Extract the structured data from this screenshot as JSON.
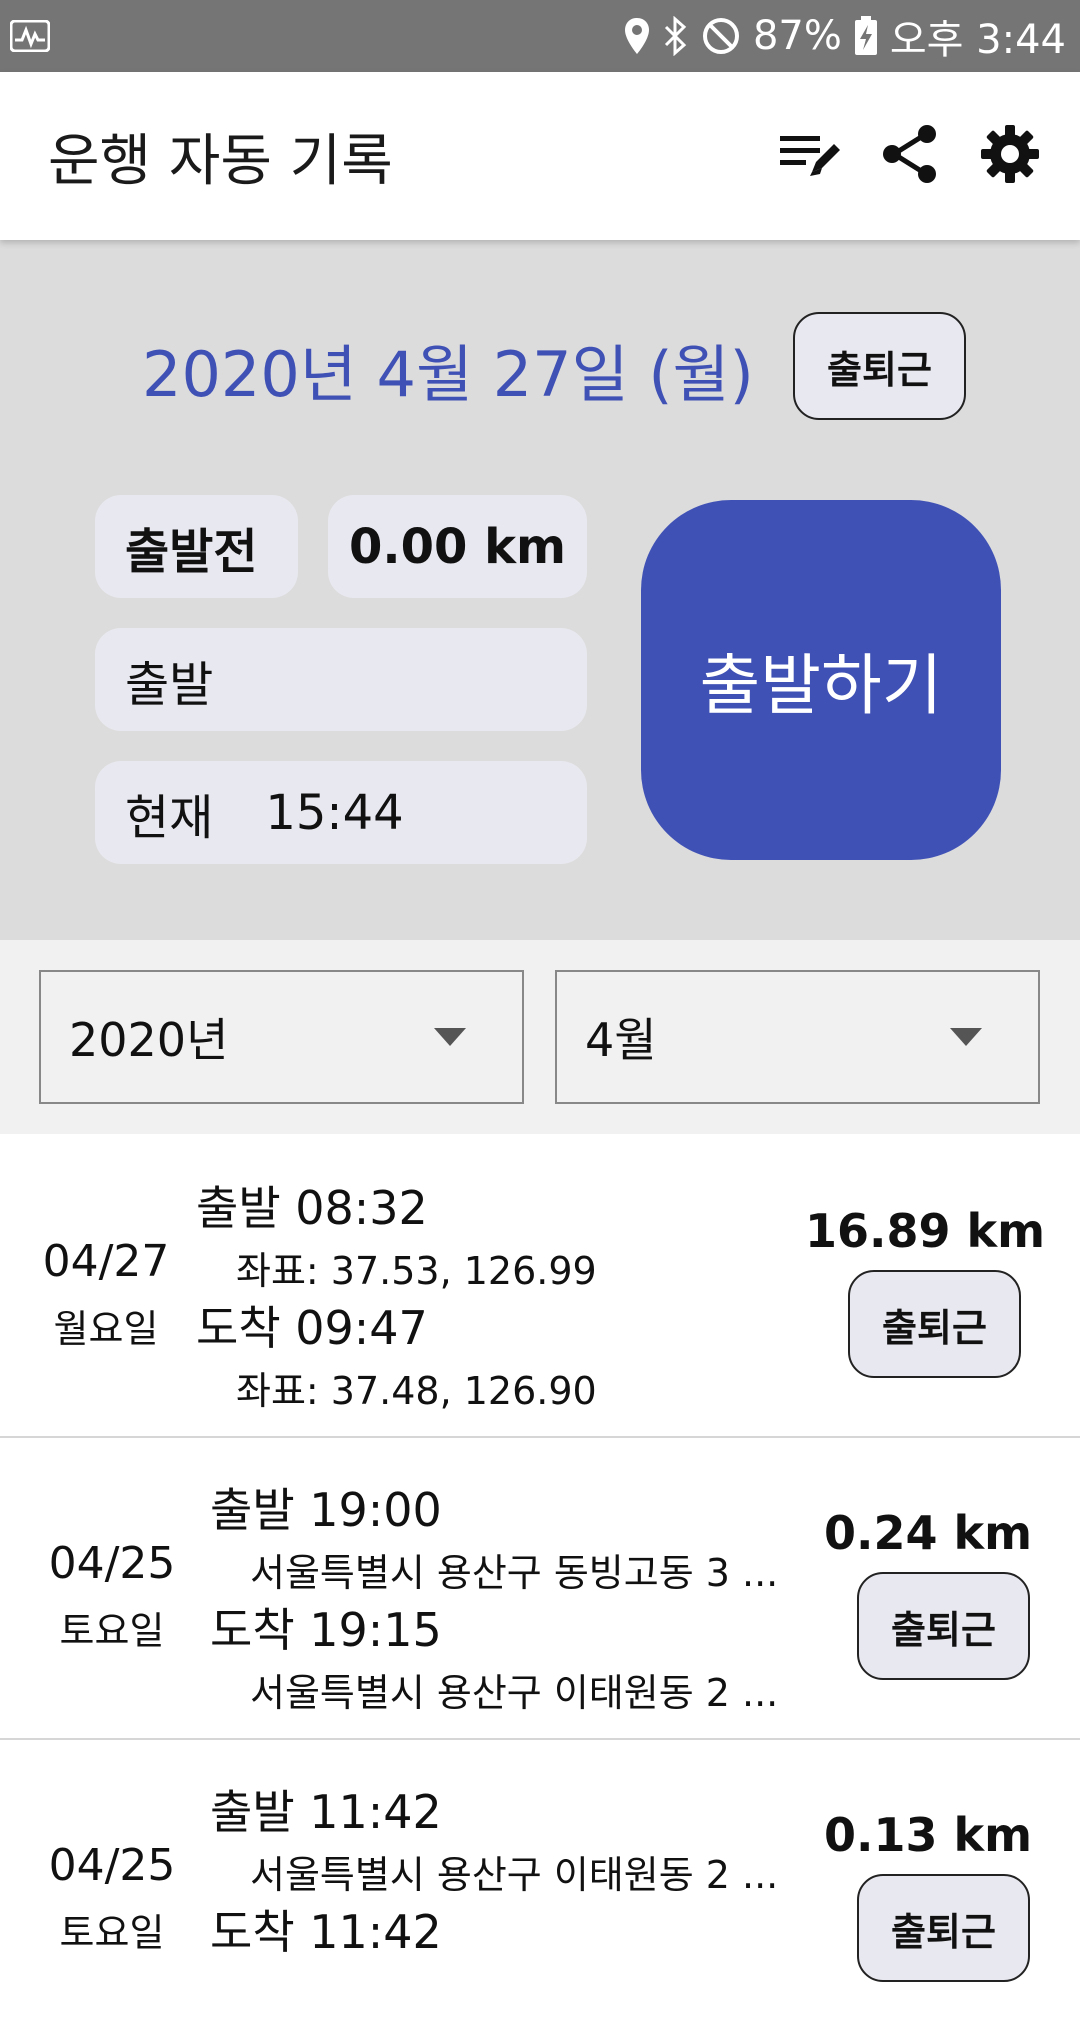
{
  "status_bar": {
    "battery": "87%",
    "time": "오후 3:44",
    "icons": [
      "activity-icon",
      "location-icon",
      "bluetooth-icon",
      "do-not-disturb-icon",
      "battery-charging-icon"
    ]
  },
  "app_bar": {
    "title": "운행 자동 기록",
    "actions": [
      "edit-list-icon",
      "share-icon",
      "settings-icon"
    ]
  },
  "top_panel": {
    "date": "2020년 4월 27일 (월)",
    "commute_label": "출퇴근",
    "status": "출발전",
    "distance": "0.00 km",
    "depart_label": "출발",
    "now_label": "현재",
    "now_time": "15:44",
    "start_button": "출발하기",
    "accent": "#3f51b5"
  },
  "filters": {
    "year": "2020년",
    "month": "4월"
  },
  "records": [
    {
      "date": "04/27",
      "weekday": "월요일",
      "depart": "출발 08:32",
      "depart_detail": "좌표: 37.53, 126.99",
      "arrive": "도착 09:47",
      "arrive_detail": "좌표: 37.48, 126.90",
      "distance": "16.89 km",
      "tag": "출퇴근"
    },
    {
      "date": "04/25",
      "weekday": "토요일",
      "depart": "출발 19:00",
      "depart_detail": "서울특별시 용산구 동빙고동  3 ...",
      "arrive": "도착 19:15",
      "arrive_detail": "서울특별시 용산구 이태원동  2 ...",
      "distance": "0.24 km",
      "tag": "출퇴근"
    },
    {
      "date": "04/25",
      "weekday": "토요일",
      "depart": "출발 11:42",
      "depart_detail": "서울특별시 용산구 이태원동  2 ...",
      "arrive": "도착 11:42",
      "distance": "0.13 km",
      "tag": "출퇴근"
    }
  ]
}
